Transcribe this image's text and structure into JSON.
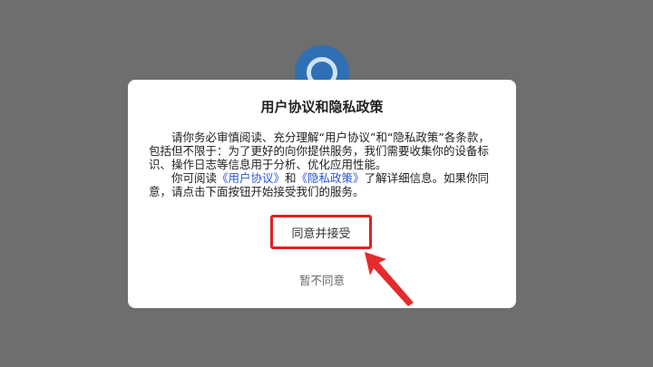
{
  "dialog": {
    "title": "用户协议和隐私政策",
    "paragraph1": "请你务必审慎阅读、充分理解“用户协议”和“隐私政策”各条款，包括但不限于：为了更好的向你提供服务，我们需要收集你的设备标识、操作日志等信息用于分析、优化应用性能。",
    "p2_prefix": "你可阅读",
    "user_agreement_link": "《用户协议》",
    "p2_and": "和",
    "privacy_policy_link": "《隐私政策》",
    "p2_suffix": "了解详细信息。如果你同意，请点击下面按钮开始接受我们的服务。",
    "agree_label": "同意并接受",
    "disagree_label": "暂不同意"
  },
  "colors": {
    "backdrop": "#6e6e6e",
    "link": "#2a56d6",
    "highlight": "#e02020"
  },
  "icons": {
    "logo": "app-logo-icon",
    "annotation": "red-arrow-icon"
  }
}
